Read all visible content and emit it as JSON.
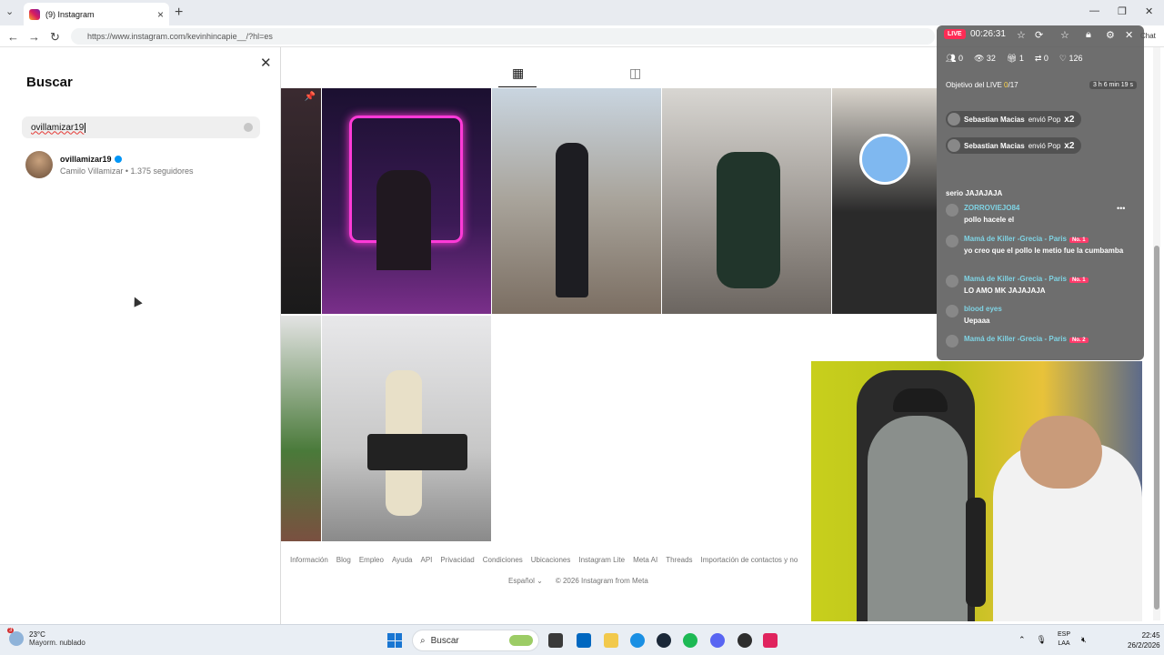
{
  "browser": {
    "tab_title": "(9) Instagram",
    "url": "https://www.instagram.com/kevinhincapie__/?hl=es",
    "chat_label": "Chat"
  },
  "search": {
    "title": "Buscar",
    "query": "ovillamizar19",
    "result": {
      "username": "ovillamizar19",
      "subtitle": "Camilo Villamizar • 1.375 seguidores",
      "verified": true
    }
  },
  "footer": {
    "links": [
      "Información",
      "Blog",
      "Empleo",
      "Ayuda",
      "API",
      "Privacidad",
      "Condiciones",
      "Ubicaciones",
      "Instagram Lite",
      "Meta AI",
      "Threads",
      "Importación de contactos y no"
    ],
    "language": "Español",
    "copyright": "© 2026 Instagram from Meta"
  },
  "live": {
    "badge": "LIVE",
    "time": "00:26:31",
    "stats": {
      "people": "0",
      "views": "32",
      "gifts": "1",
      "shares": "0",
      "likes": "126"
    },
    "goal_label": "Objetivo del LIVE",
    "goal_progress": "0",
    "goal_total": "/17",
    "goal_remaining": "3 h 6 min 19 s",
    "gifts": [
      {
        "user": "Sebastian Macias",
        "action": "envió Pop",
        "mult": "x2"
      },
      {
        "user": "Sebastian Macias",
        "action": "envió Pop",
        "mult": "x2"
      }
    ],
    "comments": [
      {
        "name": "",
        "message": "serio JAJAJAJA"
      },
      {
        "name": "ZORROVIEJO84",
        "message": "pollo hacele el"
      },
      {
        "name": "Mamá de Killer -Grecia - Paris",
        "badge": "No. 1",
        "message": "yo creo que el pollo le metio fue la cumbamba"
      },
      {
        "name": "Mamá de Killer -Grecia - Paris",
        "badge": "No. 1",
        "message": "LO AMO MK JAJAJAJA"
      },
      {
        "name": "blood eyes",
        "message": "Uepaaa"
      },
      {
        "name": "Mamá de Killer -Grecia - Paris",
        "badge": "No. 2",
        "message": ""
      }
    ]
  },
  "taskbar": {
    "temp": "23°C",
    "weather": "Mayorm. nublado",
    "weather_badge": "3",
    "search_placeholder": "Buscar",
    "lang1": "ESP",
    "lang2": "LAA",
    "time": "22:45",
    "date": "26/2/2026"
  }
}
